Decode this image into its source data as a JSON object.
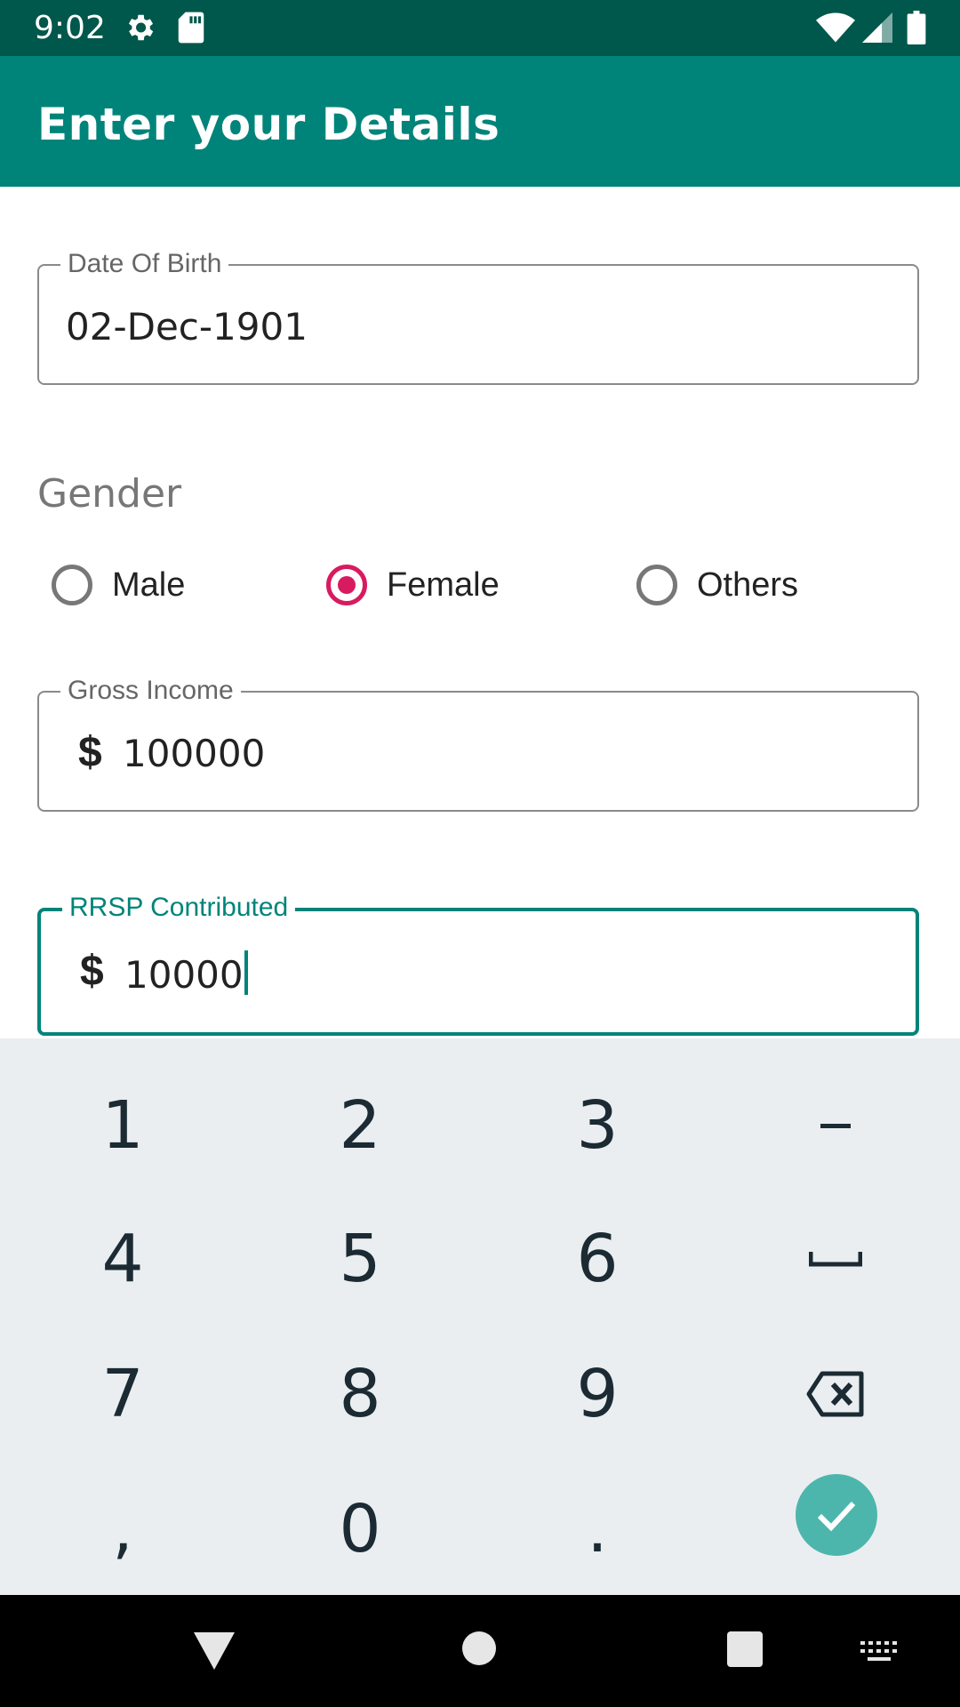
{
  "status_bar": {
    "time": "9:02",
    "icons": [
      "gear-icon",
      "sd-card-icon",
      "wifi-icon",
      "signal-icon",
      "battery-icon"
    ]
  },
  "app_bar": {
    "title": "Enter your Details"
  },
  "form": {
    "dob": {
      "label": "Date Of Birth",
      "value": "02-Dec-1901"
    },
    "gender": {
      "label": "Gender",
      "options": [
        "Male",
        "Female",
        "Others"
      ],
      "selected": "Female"
    },
    "gross_income": {
      "label": "Gross Income",
      "prefix": "$",
      "value": "100000"
    },
    "rrsp": {
      "label": "RRSP Contributed",
      "prefix": "$",
      "value": "10000"
    }
  },
  "keyboard": {
    "keys": [
      "1",
      "2",
      "3",
      "–",
      "4",
      "5",
      "6",
      "␣",
      "7",
      "8",
      "9",
      "⌫",
      ",",
      "0",
      ".",
      "✓"
    ]
  },
  "colors": {
    "status_bar": "#00574b",
    "app_bar": "#00847a",
    "accent": "#d81b60",
    "focus": "#00847a",
    "enter_key": "#4db6ac",
    "keyboard_bg": "#eaeef1"
  },
  "nav_bar": {
    "icons": [
      "back-icon",
      "home-icon",
      "recents-icon",
      "keyboard-switch-icon"
    ]
  }
}
